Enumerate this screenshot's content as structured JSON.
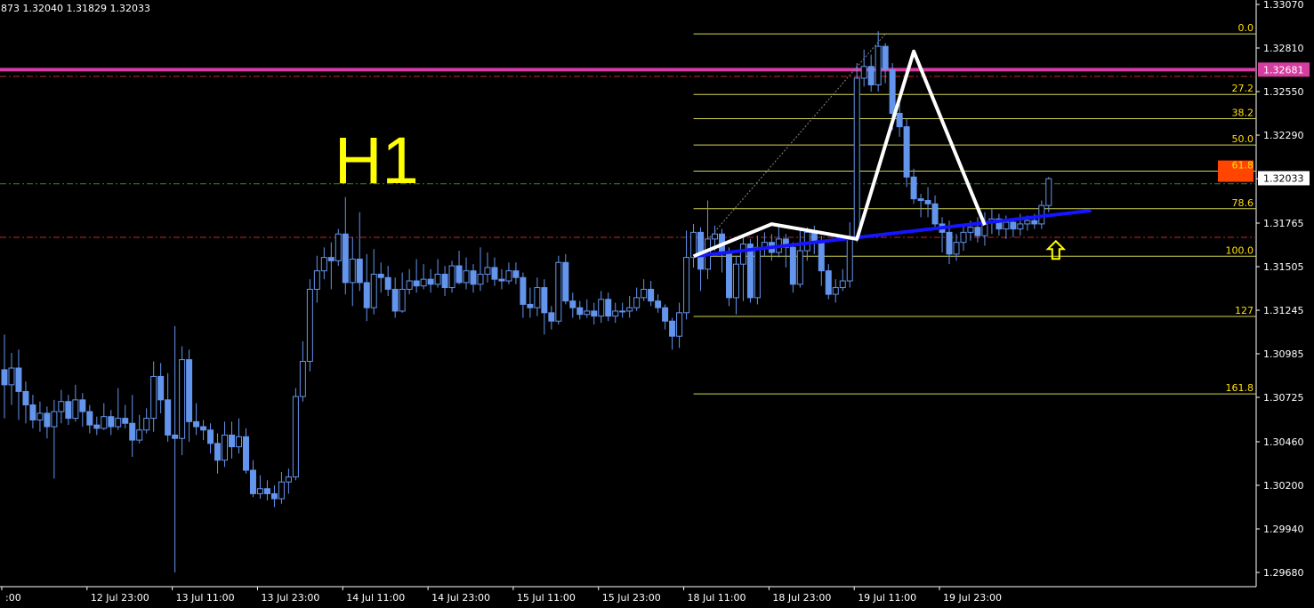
{
  "header": {
    "ohlc_text": "873 1.32040 1.31829 1.32033"
  },
  "timeframe_label": "H1",
  "colors": {
    "background": "#000000",
    "candle": "#6495ed",
    "axis": "#ffffff",
    "fib": "#d4d455",
    "fib_text": "#ffe000",
    "resistance": "#d63da0",
    "dash_red": "#c82828",
    "dash_green": "#2e8b2e",
    "trendline": "#1515ff",
    "zigzag": "#ffffff",
    "arrow": "#ffff00",
    "fib_highlight_bg": "#ff4500"
  },
  "chart_data": {
    "type": "candlestick",
    "symbol_note": "",
    "y_axis": {
      "ticks": [
        "1.33070",
        "1.32810",
        "1.32550",
        "1.32290",
        "1.32033",
        "1.31765",
        "1.31505",
        "1.31245",
        "1.30985",
        "1.30725",
        "1.30460",
        "1.30200",
        "1.29940",
        "1.29680"
      ],
      "tick_values": [
        1.3307,
        1.3281,
        1.3255,
        1.3229,
        1.3203,
        1.31765,
        1.31505,
        1.31245,
        1.30985,
        1.30725,
        1.3046,
        1.302,
        1.2994,
        1.2968
      ],
      "range": [
        1.2957,
        1.3312
      ],
      "current_price_label": "1.32033",
      "current_price": 1.32033,
      "resistance_label": "1.32681",
      "resistance_price": 1.32681
    },
    "x_axis": {
      "ticks": [
        ":00",
        "12 Jul 23:00",
        "13 Jul 11:00",
        "13 Jul 23:00",
        "14 Jul 11:00",
        "14 Jul 23:00",
        "15 Jul 11:00",
        "15 Jul 23:00",
        "18 Jul 11:00",
        "18 Jul 23:00",
        "19 Jul 11:00",
        "19 Jul 23:00"
      ],
      "tick_index": [
        0,
        12,
        24,
        36,
        48,
        60,
        72,
        84,
        96,
        108,
        120,
        132
      ]
    },
    "candles": [
      [
        1.3089,
        1.308,
        1.311,
        1.306
      ],
      [
        1.308,
        1.309,
        1.3099,
        1.3068
      ],
      [
        1.309,
        1.3076,
        1.3101,
        1.3059
      ],
      [
        1.3076,
        1.3068,
        1.3082,
        1.3057
      ],
      [
        1.3068,
        1.3059,
        1.3074,
        1.3054
      ],
      [
        1.3059,
        1.3063,
        1.307,
        1.3052
      ],
      [
        1.3063,
        1.3055,
        1.3067,
        1.3048
      ],
      [
        1.3055,
        1.3064,
        1.3071,
        1.3024
      ],
      [
        1.3064,
        1.307,
        1.3077,
        1.3057
      ],
      [
        1.307,
        1.306,
        1.3074,
        1.3056
      ],
      [
        1.306,
        1.3071,
        1.308,
        1.3058
      ],
      [
        1.3071,
        1.3064,
        1.3075,
        1.3055
      ],
      [
        1.3064,
        1.3056,
        1.3068,
        1.3051
      ],
      [
        1.3056,
        1.3054,
        1.3061,
        1.305
      ],
      [
        1.3054,
        1.3061,
        1.3069,
        1.3053
      ],
      [
        1.3061,
        1.3055,
        1.3065,
        1.305
      ],
      [
        1.3055,
        1.306,
        1.3078,
        1.3053
      ],
      [
        1.306,
        1.3057,
        1.3068,
        1.3054
      ],
      [
        1.3057,
        1.3047,
        1.3074,
        1.3037
      ],
      [
        1.3047,
        1.3053,
        1.3062,
        1.3045
      ],
      [
        1.3053,
        1.306,
        1.3066,
        1.3051
      ],
      [
        1.306,
        1.3085,
        1.3094,
        1.3052
      ],
      [
        1.3085,
        1.3071,
        1.3093,
        1.3063
      ],
      [
        1.3071,
        1.305,
        1.3087,
        1.3046
      ],
      [
        1.305,
        1.3048,
        1.3115,
        1.2968
      ],
      [
        1.3048,
        1.3095,
        1.3103,
        1.3038
      ],
      [
        1.3095,
        1.3058,
        1.3101,
        1.3046
      ],
      [
        1.3058,
        1.3055,
        1.3069,
        1.305
      ],
      [
        1.3055,
        1.3053,
        1.3059,
        1.3047
      ],
      [
        1.3053,
        1.3045,
        1.3057,
        1.3039
      ],
      [
        1.3045,
        1.3035,
        1.3051,
        1.3027
      ],
      [
        1.3035,
        1.305,
        1.3058,
        1.3031
      ],
      [
        1.305,
        1.3043,
        1.3058,
        1.3036
      ],
      [
        1.3043,
        1.3049,
        1.306,
        1.3039
      ],
      [
        1.3049,
        1.3029,
        1.3054,
        1.3027
      ],
      [
        1.3029,
        1.3015,
        1.3035,
        1.3013
      ],
      [
        1.3015,
        1.3018,
        1.3026,
        1.3012
      ],
      [
        1.3018,
        1.3015,
        1.3023,
        1.3011
      ],
      [
        1.3015,
        1.3012,
        1.302,
        1.3007
      ],
      [
        1.3012,
        1.3022,
        1.3028,
        1.3009
      ],
      [
        1.3022,
        1.3025,
        1.303,
        1.3015
      ],
      [
        1.3025,
        1.3073,
        1.3078,
        1.3023
      ],
      [
        1.3073,
        1.3094,
        1.3106,
        1.307
      ],
      [
        1.3094,
        1.3137,
        1.3143,
        1.3088
      ],
      [
        1.3137,
        1.3148,
        1.3157,
        1.3129
      ],
      [
        1.3148,
        1.3156,
        1.3162,
        1.3143
      ],
      [
        1.3156,
        1.3154,
        1.3165,
        1.3137
      ],
      [
        1.3154,
        1.317,
        1.3173,
        1.3151
      ],
      [
        1.317,
        1.3141,
        1.3192,
        1.3134
      ],
      [
        1.3141,
        1.3155,
        1.3168,
        1.3127
      ],
      [
        1.3155,
        1.3141,
        1.3183,
        1.3136
      ],
      [
        1.3141,
        1.3126,
        1.3158,
        1.3118
      ],
      [
        1.3126,
        1.3146,
        1.3161,
        1.3122
      ],
      [
        1.3146,
        1.3144,
        1.3153,
        1.3135
      ],
      [
        1.3144,
        1.3137,
        1.3151,
        1.3133
      ],
      [
        1.3137,
        1.3124,
        1.3144,
        1.312
      ],
      [
        1.3124,
        1.3137,
        1.3147,
        1.3123
      ],
      [
        1.3137,
        1.3142,
        1.3149,
        1.3134
      ],
      [
        1.3142,
        1.3139,
        1.3155,
        1.3135
      ],
      [
        1.3139,
        1.3143,
        1.3152,
        1.3137
      ],
      [
        1.3143,
        1.314,
        1.3149,
        1.3135
      ],
      [
        1.314,
        1.3146,
        1.3155,
        1.3138
      ],
      [
        1.3146,
        1.3138,
        1.3151,
        1.3133
      ],
      [
        1.3138,
        1.3151,
        1.3154,
        1.3135
      ],
      [
        1.3151,
        1.3141,
        1.316,
        1.314
      ],
      [
        1.3141,
        1.3148,
        1.3156,
        1.3137
      ],
      [
        1.3148,
        1.314,
        1.3152,
        1.3135
      ],
      [
        1.314,
        1.3146,
        1.3162,
        1.3136
      ],
      [
        1.3146,
        1.315,
        1.3159,
        1.3141
      ],
      [
        1.315,
        1.3143,
        1.3156,
        1.3139
      ],
      [
        1.3143,
        1.3142,
        1.3149,
        1.3137
      ],
      [
        1.3142,
        1.3148,
        1.3153,
        1.314
      ],
      [
        1.3148,
        1.3144,
        1.3153,
        1.314
      ],
      [
        1.3144,
        1.3128,
        1.3147,
        1.312
      ],
      [
        1.3128,
        1.3126,
        1.3138,
        1.312
      ],
      [
        1.3126,
        1.3138,
        1.3144,
        1.3121
      ],
      [
        1.3138,
        1.3123,
        1.3143,
        1.311
      ],
      [
        1.3123,
        1.3118,
        1.3127,
        1.3113
      ],
      [
        1.3118,
        1.3153,
        1.3157,
        1.3116
      ],
      [
        1.3153,
        1.313,
        1.3158,
        1.3128
      ],
      [
        1.313,
        1.3126,
        1.3135,
        1.312
      ],
      [
        1.3126,
        1.3122,
        1.313,
        1.3119
      ],
      [
        1.3122,
        1.3124,
        1.3131,
        1.312
      ],
      [
        1.3124,
        1.3121,
        1.3129,
        1.3116
      ],
      [
        1.3121,
        1.3131,
        1.3136,
        1.3117
      ],
      [
        1.3131,
        1.3121,
        1.3135,
        1.3118
      ],
      [
        1.3121,
        1.3124,
        1.3129,
        1.3117
      ],
      [
        1.3124,
        1.3124,
        1.3129,
        1.312
      ],
      [
        1.3124,
        1.3126,
        1.3133,
        1.312
      ],
      [
        1.3126,
        1.3132,
        1.3138,
        1.3124
      ],
      [
        1.3132,
        1.3137,
        1.3143,
        1.313
      ],
      [
        1.3137,
        1.313,
        1.3142,
        1.3127
      ],
      [
        1.313,
        1.3126,
        1.3134,
        1.3123
      ],
      [
        1.3126,
        1.3118,
        1.3128,
        1.3113
      ],
      [
        1.3118,
        1.3109,
        1.312,
        1.3101
      ],
      [
        1.3109,
        1.3123,
        1.3129,
        1.3102
      ],
      [
        1.3123,
        1.3156,
        1.3172,
        1.3119
      ],
      [
        1.3156,
        1.3171,
        1.3176,
        1.315
      ],
      [
        1.3171,
        1.3149,
        1.3174,
        1.3136
      ],
      [
        1.3149,
        1.3167,
        1.319,
        1.3143
      ],
      [
        1.3167,
        1.317,
        1.3175,
        1.316
      ],
      [
        1.317,
        1.3158,
        1.3173,
        1.3147
      ],
      [
        1.3158,
        1.3132,
        1.3162,
        1.3127
      ],
      [
        1.3132,
        1.3152,
        1.3157,
        1.3122
      ],
      [
        1.3152,
        1.3164,
        1.3169,
        1.313
      ],
      [
        1.3164,
        1.3132,
        1.3167,
        1.3129
      ],
      [
        1.3132,
        1.3162,
        1.3169,
        1.3128
      ],
      [
        1.3162,
        1.3165,
        1.3171,
        1.3157
      ],
      [
        1.3165,
        1.3159,
        1.317,
        1.3154
      ],
      [
        1.3159,
        1.3167,
        1.3175,
        1.3156
      ],
      [
        1.3167,
        1.3162,
        1.317,
        1.315
      ],
      [
        1.3162,
        1.314,
        1.3165,
        1.3135
      ],
      [
        1.314,
        1.316,
        1.3174,
        1.3138
      ],
      [
        1.316,
        1.3171,
        1.3174,
        1.3154
      ],
      [
        1.3171,
        1.3165,
        1.3175,
        1.3158
      ],
      [
        1.3165,
        1.3148,
        1.3169,
        1.3139
      ],
      [
        1.3148,
        1.3134,
        1.3152,
        1.3131
      ],
      [
        1.3134,
        1.3138,
        1.3143,
        1.3129
      ],
      [
        1.3138,
        1.3142,
        1.3149,
        1.3136
      ],
      [
        1.3142,
        1.3168,
        1.3177,
        1.3138
      ],
      [
        1.3168,
        1.3263,
        1.3272,
        1.3165
      ],
      [
        1.3263,
        1.327,
        1.328,
        1.3258
      ],
      [
        1.327,
        1.3259,
        1.3277,
        1.3255
      ],
      [
        1.3259,
        1.3282,
        1.3291,
        1.3255
      ],
      [
        1.3282,
        1.3268,
        1.3284,
        1.326
      ],
      [
        1.3268,
        1.3242,
        1.3272,
        1.3232
      ],
      [
        1.3242,
        1.3234,
        1.3249,
        1.3228
      ],
      [
        1.3234,
        1.3204,
        1.3239,
        1.3198
      ],
      [
        1.3204,
        1.3191,
        1.3209,
        1.3188
      ],
      [
        1.3191,
        1.319,
        1.3194,
        1.318
      ],
      [
        1.319,
        1.3188,
        1.3198,
        1.318
      ],
      [
        1.3188,
        1.3176,
        1.3193,
        1.3174
      ],
      [
        1.3176,
        1.3171,
        1.318,
        1.3159
      ],
      [
        1.3171,
        1.3158,
        1.3178,
        1.3152
      ],
      [
        1.3158,
        1.3165,
        1.317,
        1.3154
      ],
      [
        1.3165,
        1.3171,
        1.3176,
        1.316
      ],
      [
        1.3171,
        1.3174,
        1.3178,
        1.3166
      ],
      [
        1.3174,
        1.3169,
        1.318,
        1.3165
      ],
      [
        1.3169,
        1.3177,
        1.3183,
        1.3163
      ],
      [
        1.3177,
        1.3179,
        1.3185,
        1.317
      ],
      [
        1.3179,
        1.3173,
        1.3182,
        1.3169
      ],
      [
        1.3173,
        1.3177,
        1.3181,
        1.3167
      ],
      [
        1.3177,
        1.3173,
        1.3178,
        1.3168
      ],
      [
        1.3173,
        1.3176,
        1.3182,
        1.3169
      ],
      [
        1.3176,
        1.3178,
        1.3181,
        1.3172
      ],
      [
        1.3178,
        1.3176,
        1.3182,
        1.3173
      ],
      [
        1.3176,
        1.3187,
        1.319,
        1.3173
      ],
      [
        1.3187,
        1.3203,
        1.3204,
        1.3183
      ]
    ],
    "fibonacci": {
      "levels": [
        {
          "label": "0.0",
          "price": 1.32894
        },
        {
          "label": "27.2",
          "price": 1.32533
        },
        {
          "label": "38.2",
          "price": 1.32388
        },
        {
          "label": "50.0",
          "price": 1.32231
        },
        {
          "label": "61.8",
          "price": 1.32075
        },
        {
          "label": "78.6",
          "price": 1.31851
        },
        {
          "label": "100.0",
          "price": 1.31567
        },
        {
          "label": "127",
          "price": 1.31208
        },
        {
          "label": "161.8",
          "price": 1.30746
        }
      ],
      "highlighted_label": "61.8",
      "anchor_low": [
        97,
        1.31567
      ],
      "anchor_high": [
        124,
        1.32894
      ]
    },
    "horizontal_lines": [
      {
        "kind": "resistance",
        "price": 1.32681
      },
      {
        "kind": "dash-red",
        "price": 1.3264
      },
      {
        "kind": "dash-green",
        "price": 1.32
      },
      {
        "kind": "dash-red",
        "price": 1.3168
      }
    ],
    "trendline": [
      [
        97,
        1.31567
      ],
      [
        153,
        1.3184
      ]
    ],
    "zigzag": [
      [
        97,
        1.31567
      ],
      [
        108,
        1.31759
      ],
      [
        120,
        1.3167
      ],
      [
        128,
        1.3279
      ],
      [
        138,
        1.31753
      ]
    ],
    "arrow_marker": {
      "index": 148,
      "price": 1.317
    }
  }
}
